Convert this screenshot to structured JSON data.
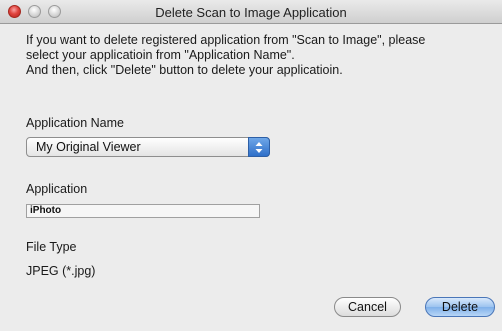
{
  "window": {
    "title": "Delete Scan to Image Application"
  },
  "message": {
    "lines": [
      "If you want to delete registered application from \"Scan to Image\", please",
      "select your applicatioin from \"Application Name\".",
      "And then, click \"Delete\" button to delete your applicatioin."
    ]
  },
  "application_name": {
    "label": "Application Name",
    "selected": "My Original Viewer"
  },
  "application": {
    "label": "Application",
    "value": "iPhoto"
  },
  "file_type": {
    "label": "File Type",
    "value": "JPEG (*.jpg)"
  },
  "buttons": {
    "cancel": "Cancel",
    "delete": "Delete"
  },
  "colors": {
    "default_button": "#7fb0ea",
    "close_button": "#e0443e",
    "window_bg": "#ececec"
  }
}
